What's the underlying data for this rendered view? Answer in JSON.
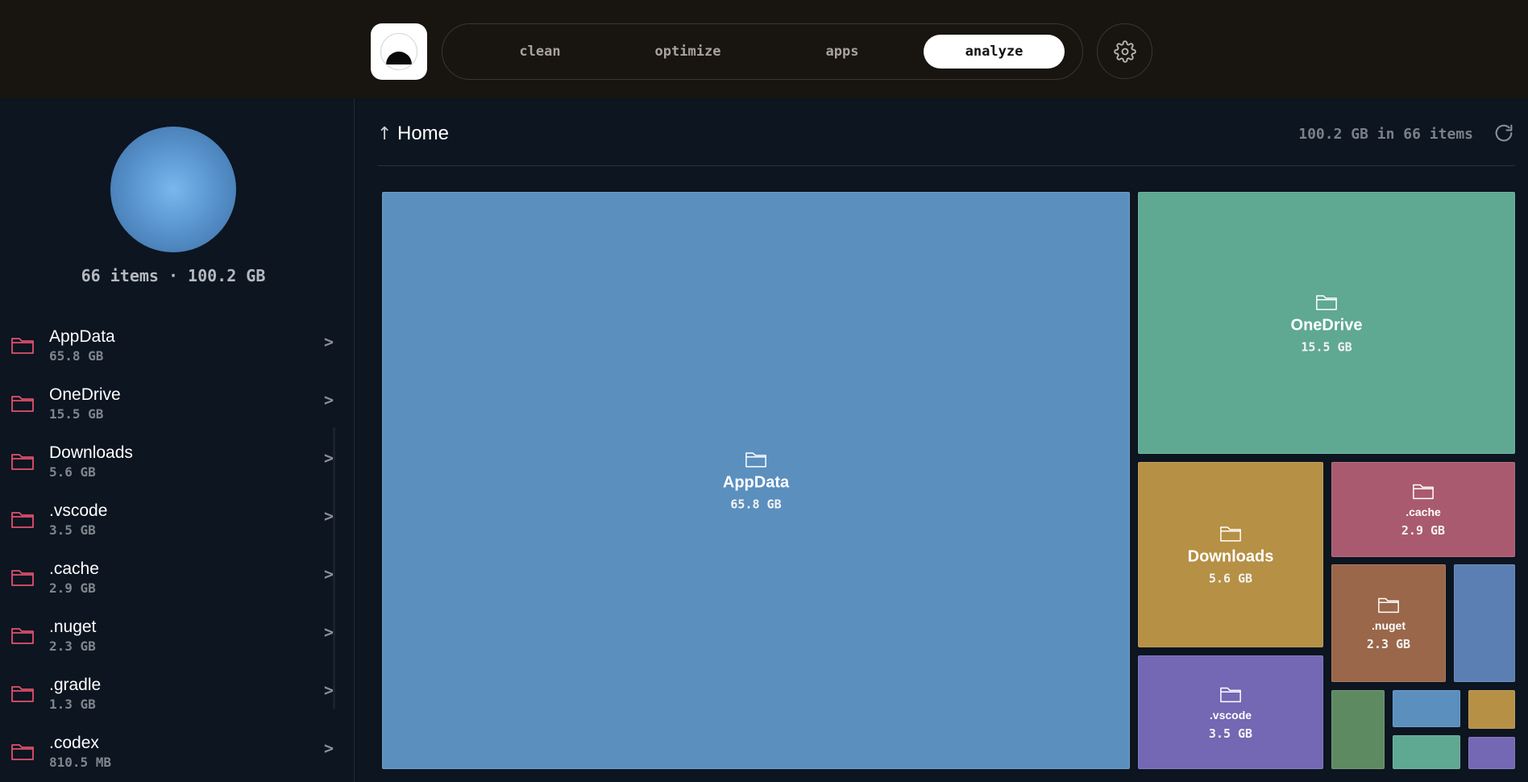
{
  "nav": {
    "tabs": [
      {
        "label": "clean",
        "active": false
      },
      {
        "label": "optimize",
        "active": false
      },
      {
        "label": "apps",
        "active": false
      },
      {
        "label": "analyze",
        "active": true
      }
    ]
  },
  "sidebar": {
    "summary": "66 items · 100.2 GB",
    "items": [
      {
        "name": "AppData",
        "size": "65.8 GB"
      },
      {
        "name": "OneDrive",
        "size": "15.5 GB"
      },
      {
        "name": "Downloads",
        "size": "5.6 GB"
      },
      {
        "name": ".vscode",
        "size": "3.5 GB"
      },
      {
        "name": ".cache",
        "size": "2.9 GB"
      },
      {
        "name": ".nuget",
        "size": "2.3 GB"
      },
      {
        "name": ".gradle",
        "size": "1.3 GB"
      },
      {
        "name": ".codex",
        "size": "810.5 MB"
      }
    ],
    "chevron": ">",
    "folder_icon_color": "#e0516e"
  },
  "main": {
    "up_arrow": "↑",
    "breadcrumb": "Home",
    "total": "100.2 GB in 66 items"
  },
  "treemap": {
    "tiles": [
      {
        "name": "AppData",
        "size": "65.8 GB",
        "color": "#5b8fbe"
      },
      {
        "name": "OneDrive",
        "size": "15.5 GB",
        "color": "#5fa892"
      },
      {
        "name": "Downloads",
        "size": "5.6 GB",
        "color": "#b69045"
      },
      {
        "name": ".vscode",
        "size": "3.5 GB",
        "color": "#7467b3"
      },
      {
        "name": ".cache",
        "size": "2.9 GB",
        "color": "#a95a6f"
      },
      {
        "name": ".nuget",
        "size": "2.3 GB",
        "color": "#9a674a"
      },
      {
        "name": "",
        "size": "",
        "color": "#5b7fb2"
      },
      {
        "name": "",
        "size": "",
        "color": "#5e8a62"
      },
      {
        "name": "",
        "size": "",
        "color": "#5b8fbe"
      },
      {
        "name": "",
        "size": "",
        "color": "#b69045"
      },
      {
        "name": "",
        "size": "",
        "color": "#5fa892"
      },
      {
        "name": "",
        "size": "",
        "color": "#7467b3"
      }
    ]
  }
}
